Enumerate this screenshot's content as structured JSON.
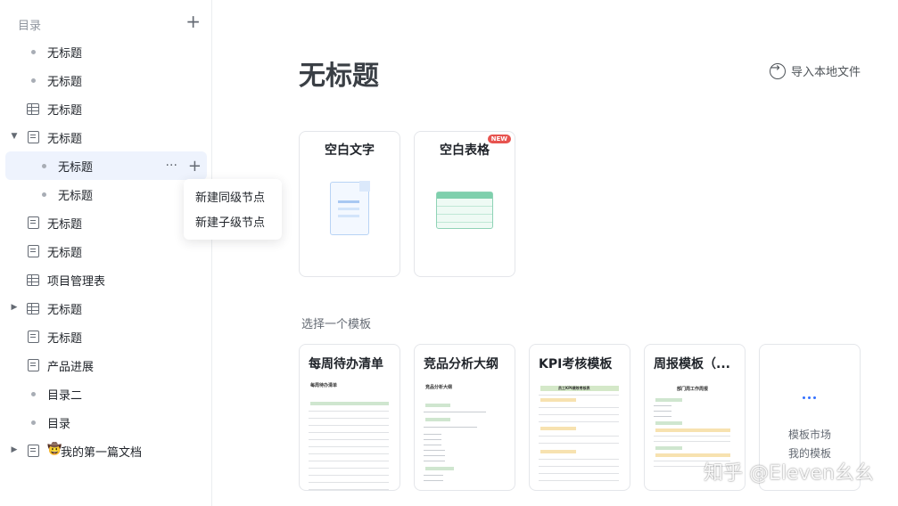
{
  "sidebar": {
    "title": "目录",
    "add_label": "+",
    "items": [
      {
        "label": "无标题",
        "icon": "dot"
      },
      {
        "label": "无标题",
        "icon": "dot"
      },
      {
        "label": "无标题",
        "icon": "sheet"
      },
      {
        "label": "无标题",
        "icon": "doc",
        "expanded": true
      },
      {
        "label": "无标题",
        "icon": "dot",
        "selected": true,
        "more": "···",
        "add": "+"
      },
      {
        "label": "无标题",
        "icon": "dot"
      },
      {
        "label": "无标题",
        "icon": "doc"
      },
      {
        "label": "无标题",
        "icon": "doc"
      },
      {
        "label": "项目管理表",
        "icon": "sheet"
      },
      {
        "label": "无标题",
        "icon": "sheet",
        "collapsed": true
      },
      {
        "label": "无标题",
        "icon": "doc"
      },
      {
        "label": "产品进展",
        "icon": "doc"
      },
      {
        "label": "目录二",
        "icon": "dot"
      },
      {
        "label": "目录",
        "icon": "dot"
      },
      {
        "label": "我的第一篇文档",
        "icon": "emoji",
        "emoji": "🤠",
        "collapsed": true
      }
    ],
    "context_menu": [
      "新建同级节点",
      "新建子级节点"
    ]
  },
  "main": {
    "title": "无标题",
    "import_label": "导入本地文件",
    "blank_cards": [
      {
        "label": "空白文字"
      },
      {
        "label": "空白表格",
        "badge": "NEW"
      }
    ],
    "templates_label": "选择一个模板",
    "templates": [
      {
        "label": "每周待办清单",
        "thumb_title": "每周待办清单"
      },
      {
        "label": "竞品分析大纲",
        "thumb_title": "竞品分析大纲"
      },
      {
        "label": "KPI考核模板",
        "thumb_title": "员工KPI绩效考核表"
      },
      {
        "label": "周报模板（...",
        "thumb_title": "部门周工作周报"
      }
    ],
    "more_card": {
      "market": "模板市场",
      "mine": "我的模板"
    }
  },
  "watermark": "知乎 @Eleven幺幺",
  "colors": {
    "accent": "#3370ff",
    "selected_bg": "#eef3fd",
    "badge": "#e7534f"
  }
}
